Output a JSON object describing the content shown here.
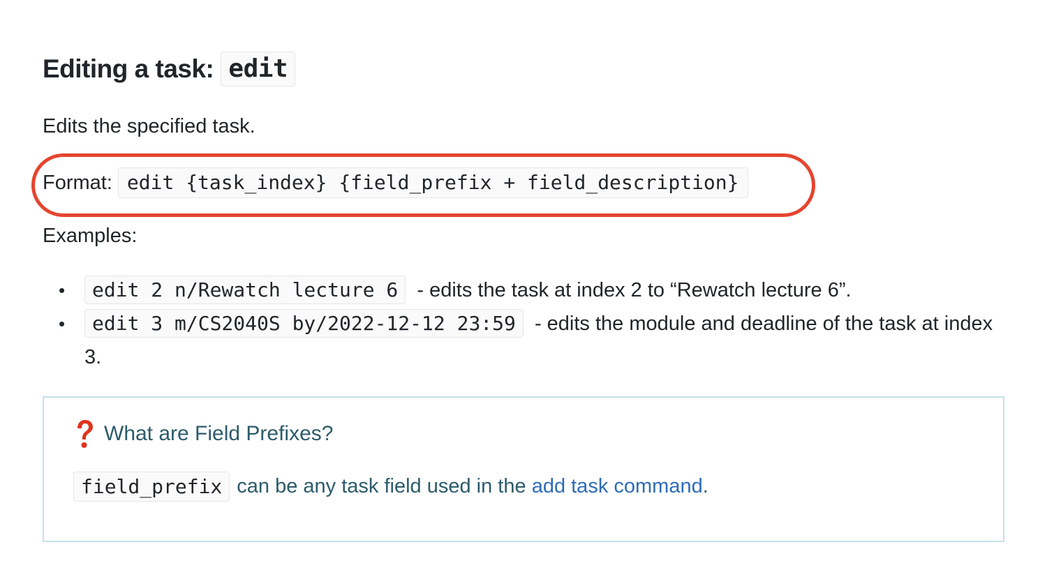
{
  "heading": {
    "text": "Editing a task:",
    "code": "edit"
  },
  "description": "Edits the specified task.",
  "format": {
    "label": "Format:",
    "code": "edit {task_index} {field_prefix + field_description}"
  },
  "examples_label": "Examples:",
  "examples": [
    {
      "code": "edit 2 n/Rewatch lecture 6",
      "text": "- edits the task at index 2 to “Rewatch lecture 6”."
    },
    {
      "code": "edit 3 m/CS2040S by/2022-12-12 23:59",
      "text": "- edits the module and deadline of the task at index 3."
    }
  ],
  "tip": {
    "icon": "question-mark-icon",
    "title": "What are Field Prefixes?",
    "code": "field_prefix",
    "text_before_link": "can be any task field used in the",
    "link_text": "add task command",
    "text_after_link": "."
  },
  "colors": {
    "highlight_ring": "#e5452f",
    "tip_border": "#c5e0ea",
    "tip_text": "#2c5b6b",
    "link": "#2e6cb8",
    "question_icon": "#e0341e"
  }
}
